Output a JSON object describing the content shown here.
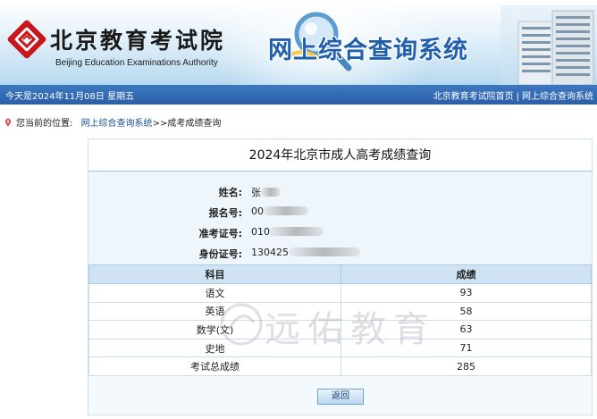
{
  "header": {
    "org_name_cn": "北京教育考试院",
    "org_name_en": "Beijing Education Examinations Authority",
    "system_title": "网上综合查询系统"
  },
  "statusbar": {
    "date_text": "今天是2024年11月08日  星期五",
    "link_home": "北京教育考试院首页",
    "separator": "|",
    "link_system": "网上综合查询系统"
  },
  "breadcrumb": {
    "prefix": "您当前的位置:",
    "link": "网上综合查询系统",
    "current": ">>成考成绩查询"
  },
  "panel": {
    "title": "2024年北京市成人高考成绩查询",
    "info": [
      {
        "label": "姓名:",
        "value": "张"
      },
      {
        "label": "报名号:",
        "value": "00"
      },
      {
        "label": "准考证号:",
        "value": "010"
      },
      {
        "label": "身份证号:",
        "value": "130425"
      }
    ],
    "table": {
      "headers": [
        "科目",
        "成绩"
      ],
      "rows": [
        [
          "语文",
          "93"
        ],
        [
          "英语",
          "58"
        ],
        [
          "数学(文)",
          "63"
        ],
        [
          "史地",
          "71"
        ],
        [
          "考试总成绩",
          "285"
        ]
      ]
    },
    "back_label": "返回"
  },
  "watermark": {
    "text": "远佑教育"
  },
  "colors": {
    "brand_red": "#c8161d",
    "title_blue": "#1f5fae",
    "statusbar_blue": "#2a5ea8",
    "table_header": "#cfe3f3"
  }
}
